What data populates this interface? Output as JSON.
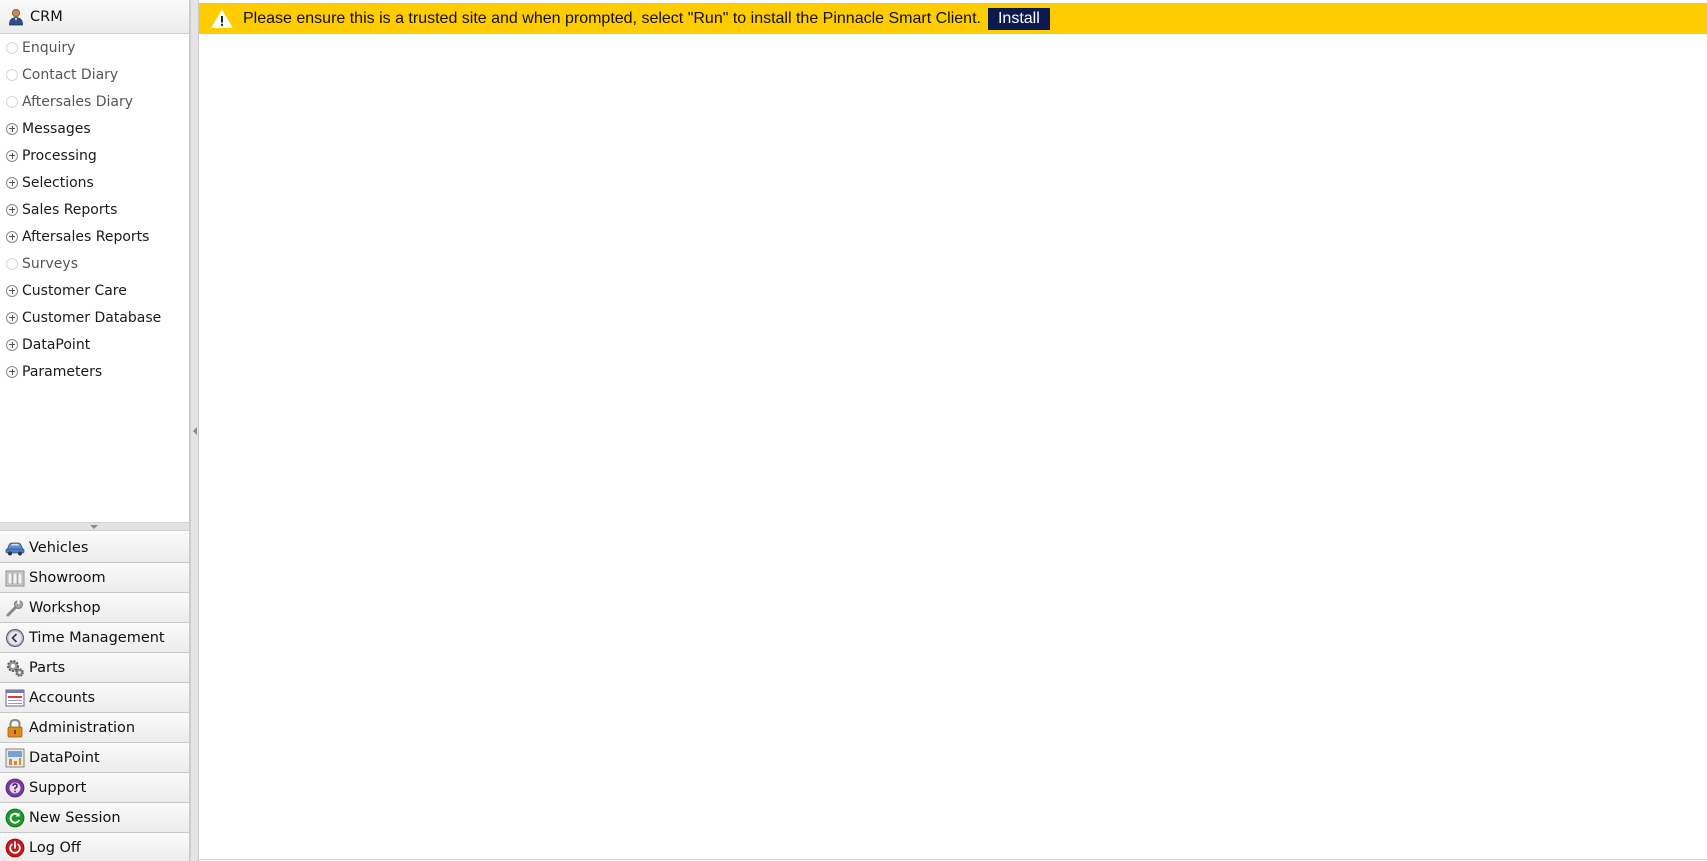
{
  "sidebar": {
    "header": {
      "label": "CRM",
      "icon": "user-icon"
    },
    "tree": [
      {
        "label": "Enquiry",
        "expandable": false
      },
      {
        "label": "Contact Diary",
        "expandable": false
      },
      {
        "label": "Aftersales Diary",
        "expandable": false
      },
      {
        "label": "Messages",
        "expandable": true
      },
      {
        "label": "Processing",
        "expandable": true
      },
      {
        "label": "Selections",
        "expandable": true
      },
      {
        "label": "Sales Reports",
        "expandable": true
      },
      {
        "label": "Aftersales Reports",
        "expandable": true
      },
      {
        "label": "Surveys",
        "expandable": false
      },
      {
        "label": "Customer Care",
        "expandable": true
      },
      {
        "label": "Customer Database",
        "expandable": true
      },
      {
        "label": "DataPoint",
        "expandable": true
      },
      {
        "label": "Parameters",
        "expandable": true
      }
    ],
    "nav": [
      {
        "label": "Vehicles",
        "icon": "car-icon"
      },
      {
        "label": "Showroom",
        "icon": "showroom-icon"
      },
      {
        "label": "Workshop",
        "icon": "wrench-icon"
      },
      {
        "label": "Time Management",
        "icon": "clock-icon"
      },
      {
        "label": "Parts",
        "icon": "gear-icon"
      },
      {
        "label": "Accounts",
        "icon": "ledger-icon"
      },
      {
        "label": "Administration",
        "icon": "lock-icon"
      },
      {
        "label": "DataPoint",
        "icon": "datapoint-icon"
      },
      {
        "label": "Support",
        "icon": "support-icon"
      },
      {
        "label": "New Session",
        "icon": "refresh-icon"
      },
      {
        "label": "Log Off",
        "icon": "power-icon"
      }
    ]
  },
  "banner": {
    "message": "Please ensure this is a trusted site and when prompted, select \"Run\" to install the Pinnacle Smart Client.",
    "install_label": "Install",
    "icon": "warning-icon",
    "color": "#ffcc00",
    "button_color": "#0b1a4f"
  }
}
